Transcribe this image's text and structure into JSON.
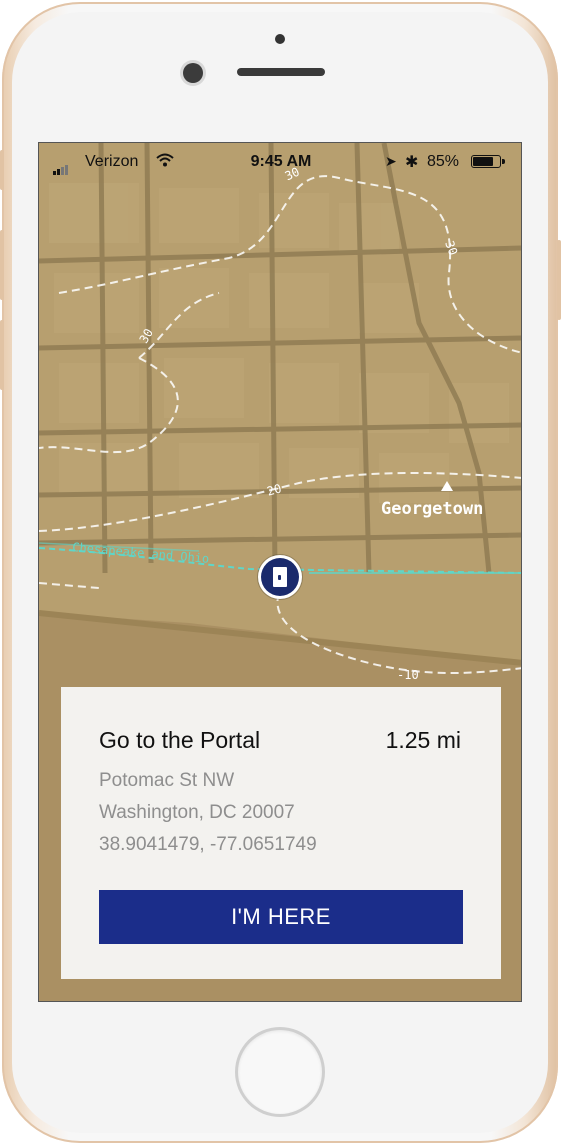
{
  "status_bar": {
    "carrier": "Verizon",
    "time": "9:45 AM",
    "battery_percent": "85%",
    "battery_level": 0.85,
    "icons": [
      "signal-icon",
      "wifi-icon",
      "location-arrow-icon",
      "bluetooth-icon",
      "battery-icon"
    ]
  },
  "map": {
    "place_label": "Georgetown",
    "canal_label": "Chesapeake and Ohio",
    "contours": [
      "30",
      "30",
      "30",
      "20",
      "-10"
    ]
  },
  "destination_card": {
    "title": "Go to the Portal",
    "distance": "1.25 mi",
    "street": "Potomac St NW",
    "city": "Washington, DC 20007",
    "coordinates": "38.9041479, -77.0651749",
    "button_label": "I'M HERE"
  },
  "colors": {
    "map_base": "#b79f6f",
    "button": "#1b2d8a",
    "pin": "#1a2a6c",
    "canal": "#5fd6c8"
  }
}
